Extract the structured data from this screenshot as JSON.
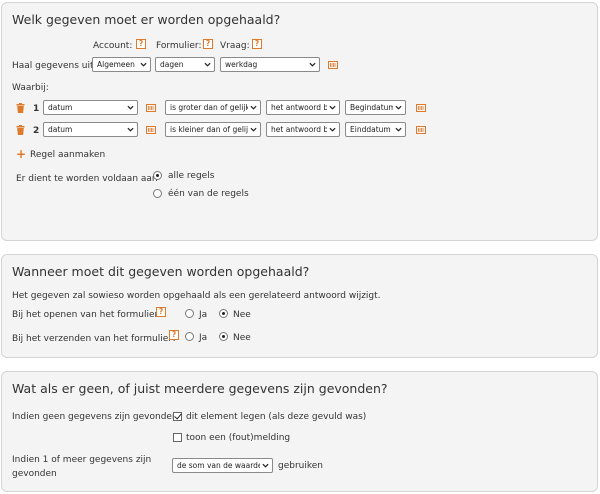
{
  "section1": {
    "title": "Welk gegeven moet er worden opgehaald?",
    "col_account": "Account:",
    "col_formulier": "Formulier:",
    "col_vraag": "Vraag:",
    "help": "?",
    "fetch_label": "Haal gegevens uit",
    "account_value": "Algemeen",
    "formulier_value": "dagen",
    "vraag_value": "werkdag",
    "waarbij_label": "Waarbij:",
    "rules": [
      {
        "num": "1",
        "field": "datum",
        "operator": "is groter dan of gelijk a",
        "compare": "het antwoord bij",
        "target": "Begindatum"
      },
      {
        "num": "2",
        "field": "datum",
        "operator": "is kleiner dan of gelijk",
        "compare": "het antwoord bij",
        "target": "Einddatum"
      }
    ],
    "add_rule": "Regel aanmaken",
    "must_satisfy": "Er dient te worden voldaan aan",
    "option_all": "alle regels",
    "option_one": "één van de regels"
  },
  "section2": {
    "title": "Wanneer moet dit gegeven worden opgehaald?",
    "info": "Het gegeven zal sowieso worden opgehaald als een gerelateerd antwoord wijzigt.",
    "on_open": "Bij het openen van het formulier?",
    "on_submit": "Bij het verzenden van het formulier?",
    "yes": "Ja",
    "no": "Nee"
  },
  "section3": {
    "title": "Wat als er geen, of juist meerdere gegevens zijn gevonden?",
    "none_found": "Indien geen gegevens zijn gevonden",
    "clear_element": "dit element legen (als deze gevuld was)",
    "show_error": "toon een (fout)melding",
    "multi_found_1": "Indien 1 of meer gegevens zijn",
    "multi_found_2": "gevonden",
    "aggregate_value": "de som van de waarden",
    "use_label": "gebruiken"
  },
  "colors": {
    "accent": "#e07a2b",
    "panel": "#f4f4f4"
  }
}
